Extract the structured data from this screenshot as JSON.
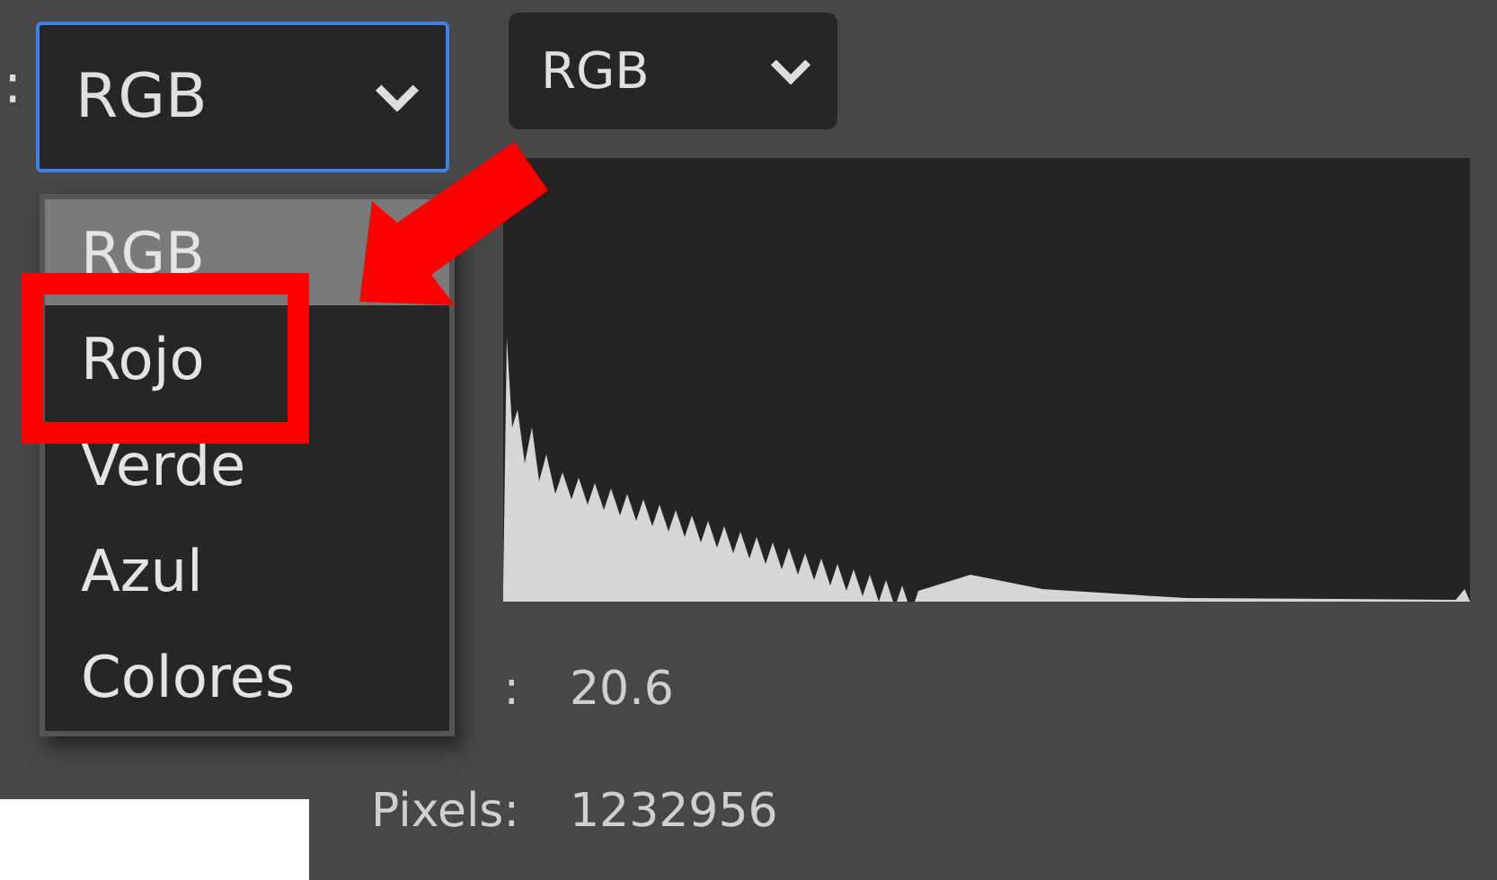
{
  "channel_label": ":",
  "channel_select": {
    "value": "RGB",
    "focused": true
  },
  "mode_select": {
    "value": "RGB"
  },
  "channel_menu": {
    "options": [
      {
        "label": "RGB",
        "selected": true
      },
      {
        "label": "Rojo",
        "selected": false
      },
      {
        "label": "Verde",
        "selected": false
      },
      {
        "label": "Azul",
        "selected": false
      },
      {
        "label": "Colores",
        "selected": false
      }
    ]
  },
  "stats": [
    {
      "label": ":",
      "value": "20.6"
    },
    {
      "label": "Pixels:",
      "value": "1232956"
    }
  ]
}
